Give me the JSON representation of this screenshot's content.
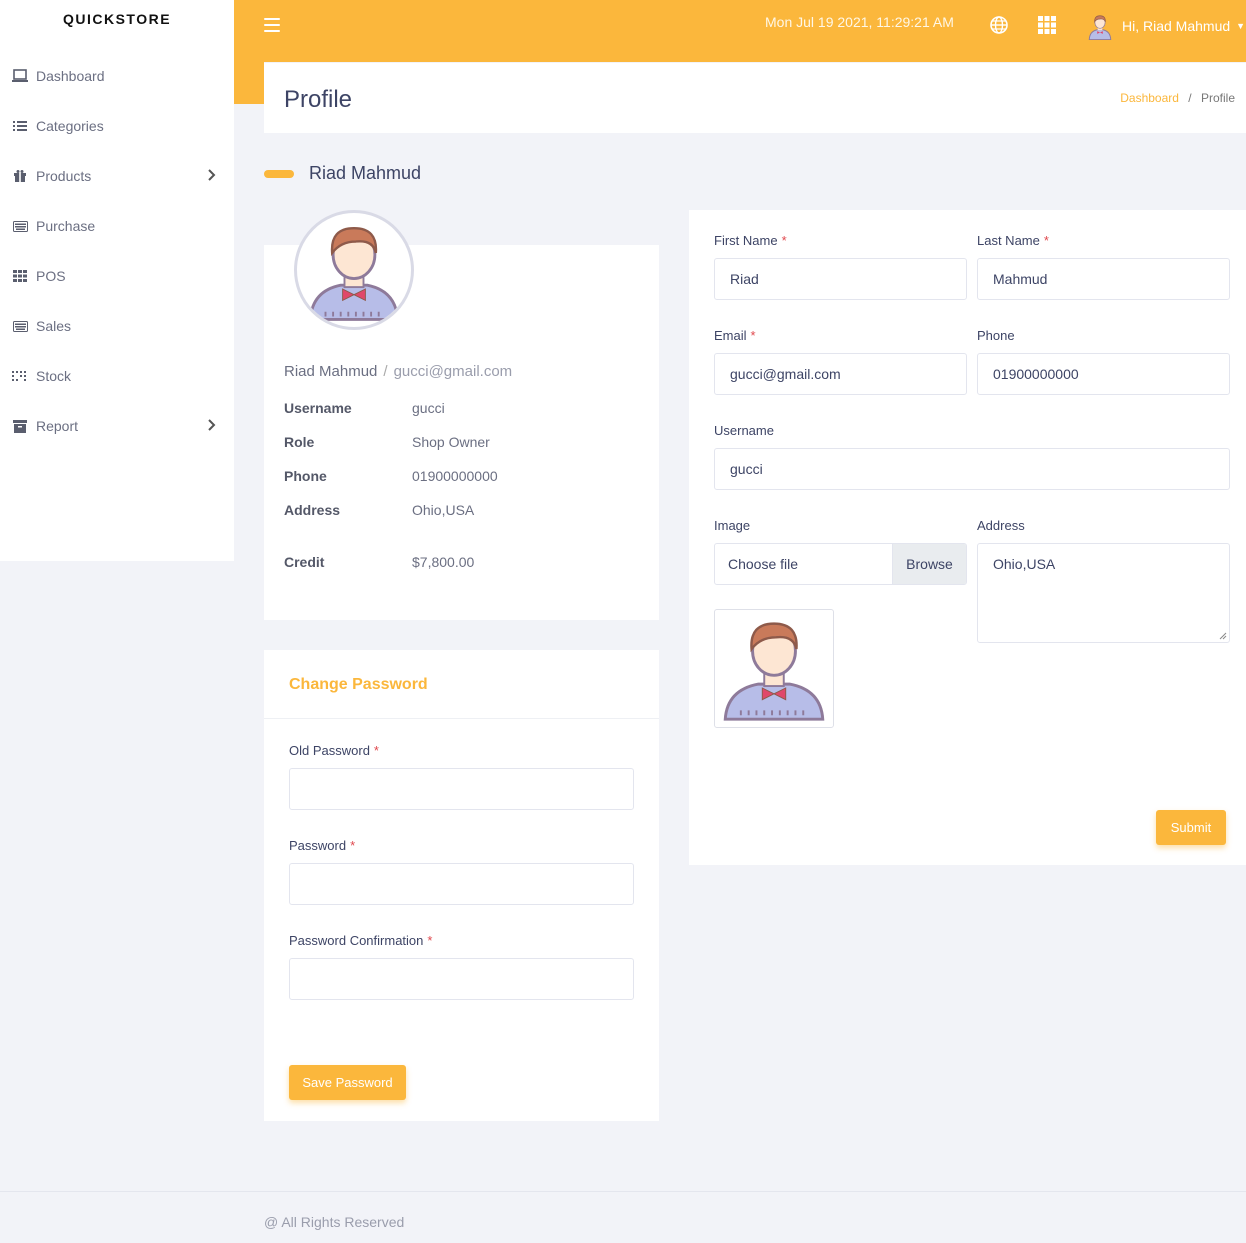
{
  "app": {
    "brand": "QUICKSTORE"
  },
  "sidebar": {
    "items": [
      {
        "label": "Dashboard",
        "icon": "laptop-icon",
        "has_submenu": false
      },
      {
        "label": "Categories",
        "icon": "list-icon",
        "has_submenu": false
      },
      {
        "label": "Products",
        "icon": "gift-icon",
        "has_submenu": true
      },
      {
        "label": "Purchase",
        "icon": "keyboard-icon",
        "has_submenu": false
      },
      {
        "label": "POS",
        "icon": "grid-icon",
        "has_submenu": false
      },
      {
        "label": "Sales",
        "icon": "keyboard-icon",
        "has_submenu": false
      },
      {
        "label": "Stock",
        "icon": "dots-grid-icon",
        "has_submenu": false
      },
      {
        "label": "Report",
        "icon": "archive-icon",
        "has_submenu": true
      }
    ]
  },
  "header": {
    "datetime": "Mon Jul 19 2021, 11:29:21 AM",
    "greeting": "Hi, Riad Mahmud",
    "accent": "#fbb73c"
  },
  "page": {
    "title": "Profile",
    "breadcrumb": {
      "home": "Dashboard",
      "separator": "/",
      "current": "Profile"
    },
    "section_name": "Riad Mahmud"
  },
  "profile": {
    "name": "Riad Mahmud",
    "separator": "/",
    "email": "gucci@gmail.com",
    "rows": {
      "username": {
        "key": "Username",
        "value": "gucci"
      },
      "role": {
        "key": "Role",
        "value": "Shop Owner"
      },
      "phone": {
        "key": "Phone",
        "value": "01900000000"
      },
      "address": {
        "key": "Address",
        "value": "Ohio,USA"
      },
      "credit": {
        "key": "Credit",
        "value": "$7,800.00"
      }
    }
  },
  "password": {
    "title": "Change Password",
    "old_label": "Old Password",
    "new_label": "Password",
    "confirm_label": "Password Confirmation",
    "required_mark": "*",
    "save_label": "Save Password"
  },
  "form": {
    "first_name_label": "First Name",
    "first_name_value": "Riad",
    "last_name_label": "Last Name",
    "last_name_value": "Mahmud",
    "email_label": "Email",
    "email_value": "gucci@gmail.com",
    "phone_label": "Phone",
    "phone_value": "01900000000",
    "username_label": "Username",
    "username_value": "gucci",
    "image_label": "Image",
    "file_placeholder": "Choose file",
    "browse_label": "Browse",
    "address_label": "Address",
    "address_value": "Ohio,USA",
    "required_mark": "*",
    "submit_label": "Submit"
  },
  "footer": {
    "text": "@ All Rights Reserved"
  }
}
